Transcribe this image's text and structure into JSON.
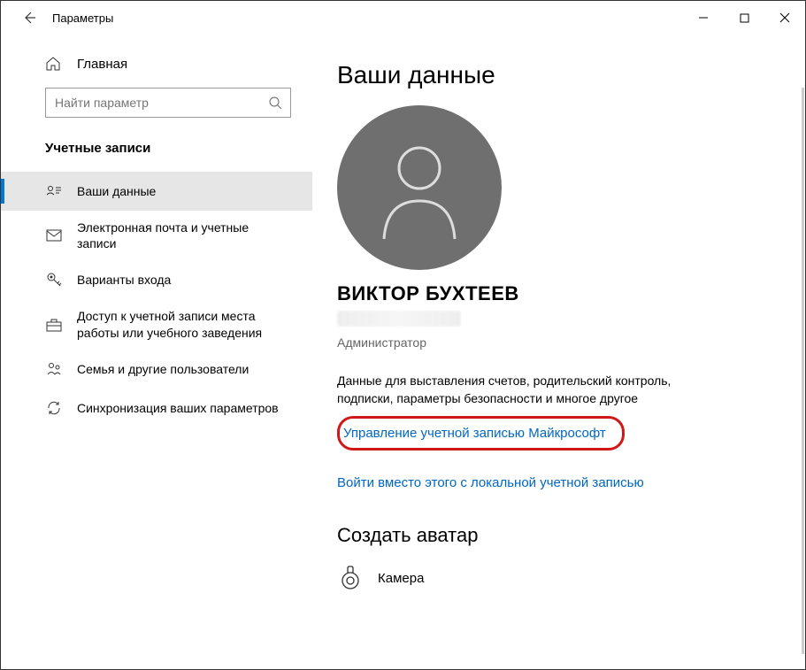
{
  "titlebar": {
    "title": "Параметры"
  },
  "sidebar": {
    "home": "Главная",
    "search_placeholder": "Найти параметр",
    "section": "Учетные записи",
    "items": [
      {
        "label": "Ваши данные"
      },
      {
        "label": "Электронная почта и учетные записи"
      },
      {
        "label": "Варианты входа"
      },
      {
        "label": "Доступ к учетной записи места работы или учебного заведения"
      },
      {
        "label": "Семья и другие пользователи"
      },
      {
        "label": "Синхронизация ваших параметров"
      }
    ]
  },
  "main": {
    "page_title": "Ваши данные",
    "username": "ВИКТОР БУХТЕЕВ",
    "role": "Администратор",
    "billing_desc": "Данные для выставления счетов, родительский контроль, подписки, параметры безопасности и многое другое",
    "manage_link": "Управление учетной записью Майкрософт",
    "local_link": "Войти вместо этого с локальной учетной записью",
    "avatar_section": "Создать аватар",
    "camera": "Камера"
  }
}
